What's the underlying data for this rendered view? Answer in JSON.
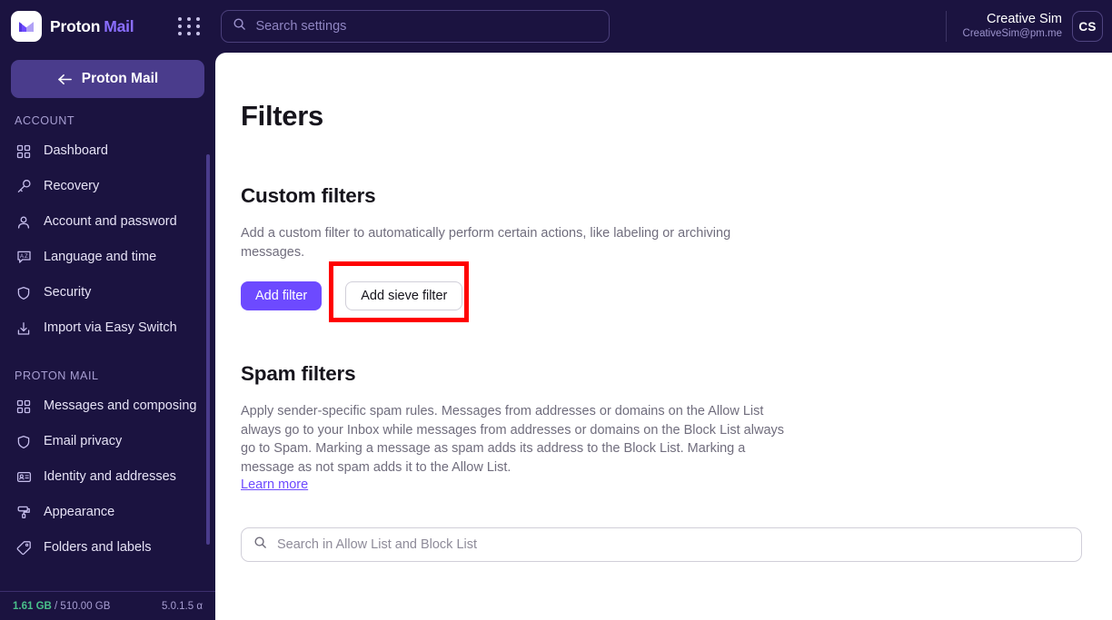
{
  "header": {
    "brand_proton": "Proton",
    "brand_mail": "Mail",
    "logo_icon": "proton-mail-envelope-logo",
    "apps_icon": "app-grid-icon",
    "search_icon": "search-icon",
    "search_value": "",
    "search_placeholder": "Search settings",
    "user_name": "Creative Sim",
    "user_email": "CreativeSim@pm.me",
    "avatar_initials": "CS"
  },
  "sidebar": {
    "back_label": "Proton Mail",
    "back_icon": "arrow-left-icon",
    "groups": [
      {
        "title": "ACCOUNT",
        "items": [
          {
            "label": "Dashboard",
            "icon": "grid-squares-icon"
          },
          {
            "label": "Recovery",
            "icon": "key-icon"
          },
          {
            "label": "Account and password",
            "icon": "person-icon"
          },
          {
            "label": "Language and time",
            "icon": "translate-bubble-icon"
          },
          {
            "label": "Security",
            "icon": "shield-icon"
          },
          {
            "label": "Import via Easy Switch",
            "icon": "import-tray-icon"
          }
        ]
      },
      {
        "title": "PROTON MAIL",
        "items": [
          {
            "label": "Messages and composing",
            "icon": "grid-squares-icon"
          },
          {
            "label": "Email privacy",
            "icon": "shield-icon"
          },
          {
            "label": "Identity and addresses",
            "icon": "id-card-icon"
          },
          {
            "label": "Appearance",
            "icon": "paint-roller-icon"
          },
          {
            "label": "Folders and labels",
            "icon": "tag-icon"
          }
        ]
      }
    ],
    "footer": {
      "storage_used": "1.61 GB",
      "storage_total": "/ 510.00 GB",
      "version": "5.0.1.5 α"
    }
  },
  "main": {
    "page_title": "Filters",
    "custom_filters": {
      "title": "Custom filters",
      "description": "Add a custom filter to automatically perform certain actions, like labeling or archiving messages.",
      "add_filter_label": "Add filter",
      "add_sieve_filter_label": "Add sieve filter"
    },
    "spam_filters": {
      "title": "Spam filters",
      "description": "Apply sender-specific spam rules. Messages from addresses or domains on the Allow List always go to your Inbox while messages from addresses or domains on the Block List always go to Spam. Marking a message as spam adds its address to the Block List. Marking a message as not spam adds it to the Allow List.",
      "learn_more_label": "Learn more",
      "search_icon": "search-icon",
      "search_value": "",
      "search_placeholder": "Search in Allow List and Block List"
    }
  },
  "annotation": {
    "highlight_color": "#ff0000",
    "target": "add-sieve-filter-button"
  },
  "colors": {
    "sidebar_bg": "#1b1340",
    "accent_purple": "#6d4aff",
    "brand_mail_purple": "#8a6eff",
    "storage_green": "#49c08a",
    "highlight_red": "#ff0000"
  }
}
